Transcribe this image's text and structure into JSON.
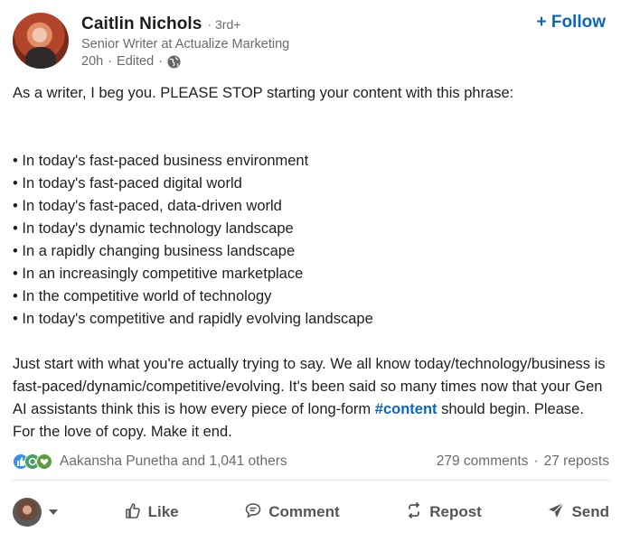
{
  "author": {
    "name": "Caitlin Nichols",
    "degree": "· 3rd+",
    "headline": "Senior Writer at Actualize Marketing",
    "time": "20h",
    "edited": "Edited",
    "separator": "·"
  },
  "follow_label": "+ Follow",
  "post": {
    "intro": "As a writer, I beg you. PLEASE STOP starting your content with this phrase:",
    "bullets": [
      "• In today's fast-paced business environment",
      "• In today's fast-paced digital world",
      "• In today's fast-paced, data-driven world",
      "• In today's dynamic technology landscape",
      "• In a rapidly changing business landscape",
      "• In an increasingly competitive marketplace",
      "• In the competitive world of technology",
      "• In today's competitive and rapidly evolving landscape"
    ],
    "outro_before": "Just start with what you're actually trying to say. We all know today/technology/business is fast-paced/dynamic/competitive/evolving. It's been said so many times now that your Gen AI assistants think this is how every piece of long-form ",
    "hashtag": "#content",
    "outro_after": " should begin. Please. For the love of copy. Make it end."
  },
  "social": {
    "reactors": "Aakansha Punetha and 1,041 others",
    "comments": "279 comments",
    "separator": "·",
    "reposts": "27 reposts"
  },
  "actions": {
    "like": "Like",
    "comment": "Comment",
    "repost": "Repost",
    "send": "Send"
  },
  "colors": {
    "accent": "#0a66c2",
    "muted_text": "#6b6b6b",
    "body_text": "#1f1f1f"
  }
}
